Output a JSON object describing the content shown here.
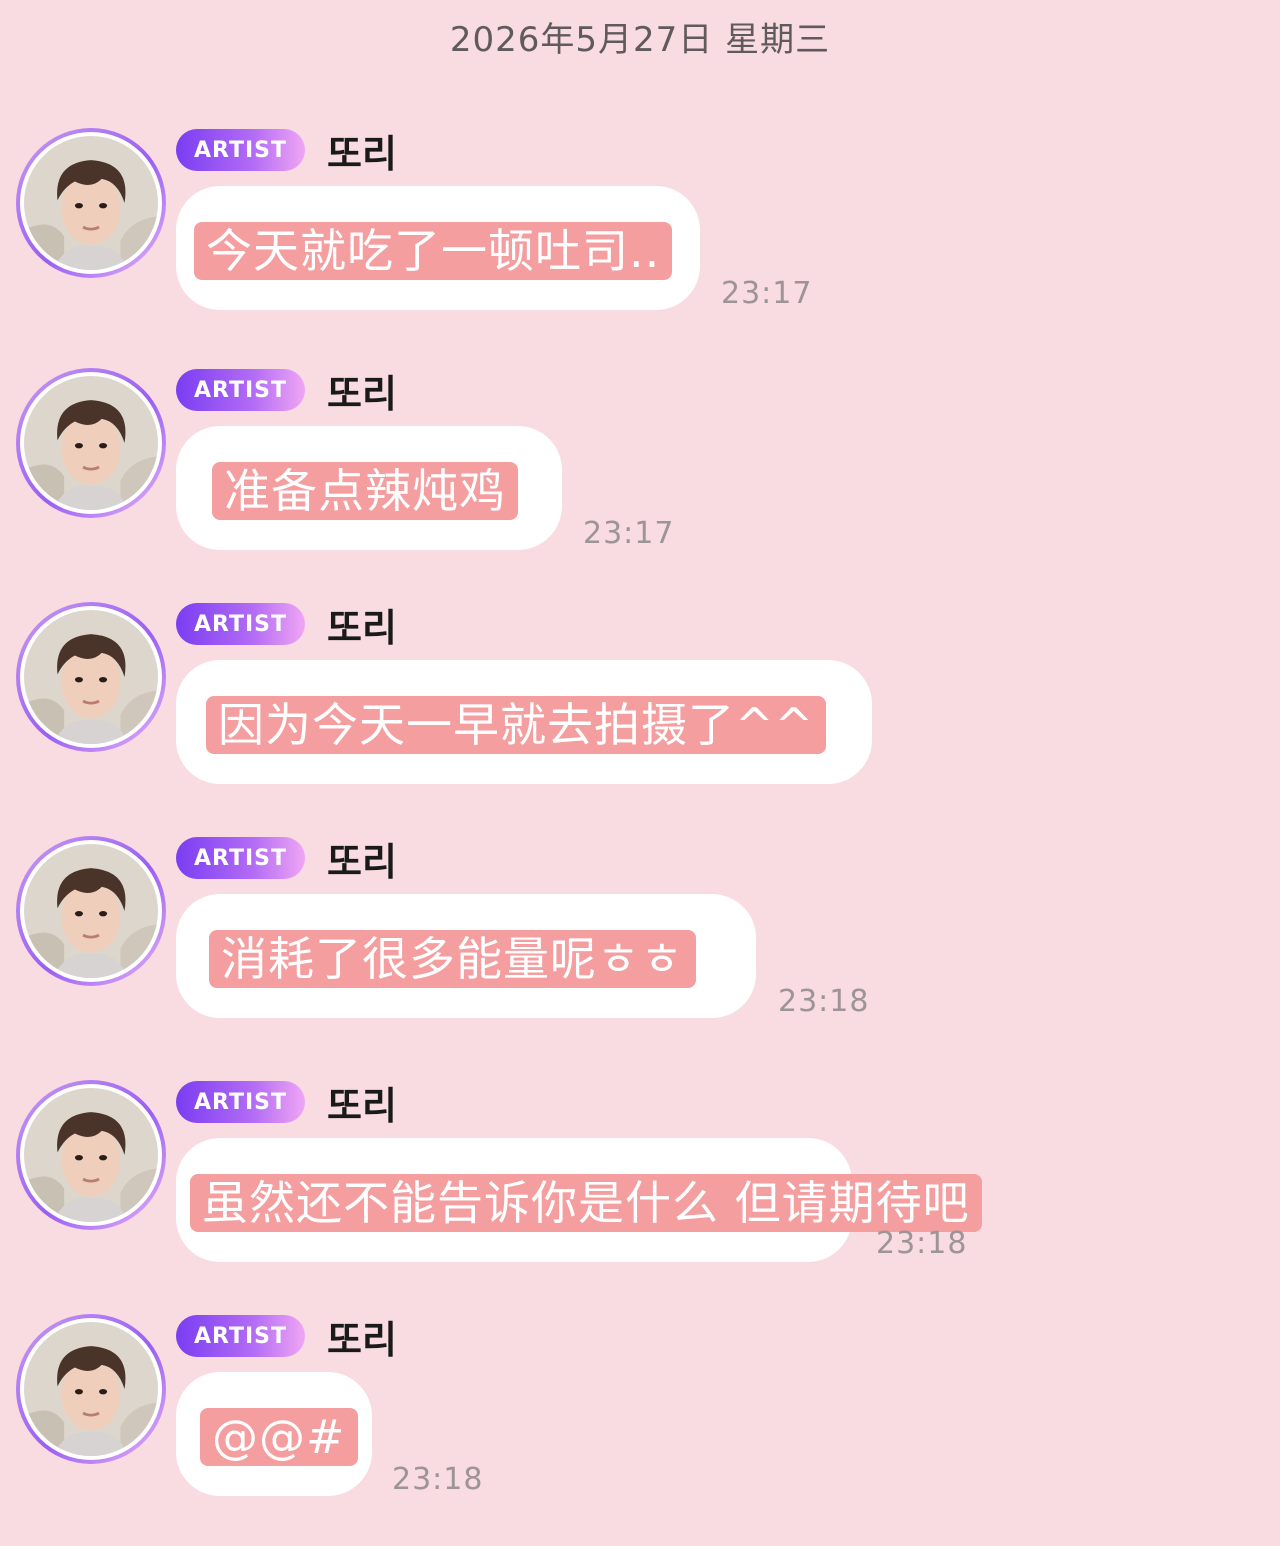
{
  "date_header": "2026年5月27日 星期三",
  "messages": [
    {
      "badge": "ARTIST",
      "sender": "또리",
      "text": "今天就吃了一顿吐司..",
      "time": "23:17"
    },
    {
      "badge": "ARTIST",
      "sender": "또리",
      "text": "准备点辣炖鸡",
      "time": "23:17"
    },
    {
      "badge": "ARTIST",
      "sender": "또리",
      "text": "因为今天一早就去拍摄了^^",
      "time": ""
    },
    {
      "badge": "ARTIST",
      "sender": "또리",
      "text": "消耗了很多能量呢ㅎㅎ",
      "time": "23:18"
    },
    {
      "badge": "ARTIST",
      "sender": "또리",
      "text": "虽然还不能告诉你是什么 但请期待吧",
      "time": "23:18"
    },
    {
      "badge": "ARTIST",
      "sender": "또리",
      "text": "@@#",
      "time": "23:18"
    }
  ]
}
